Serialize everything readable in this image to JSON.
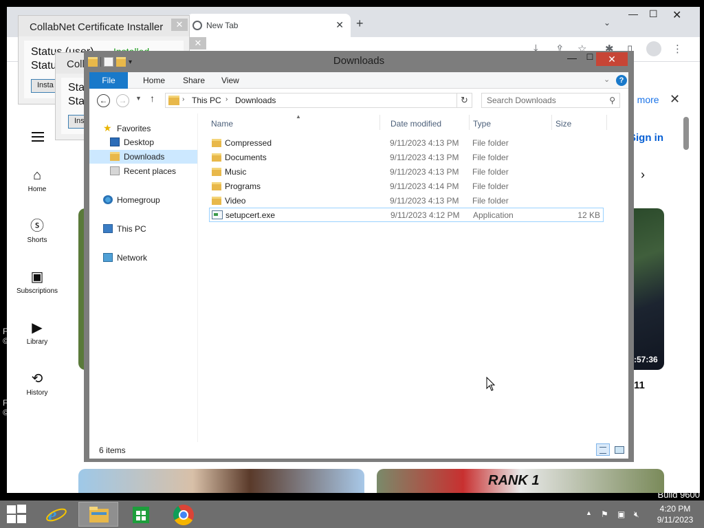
{
  "desktop": {
    "build_text": "Build 9600",
    "side_letters": [
      "F",
      "©",
      "F",
      "©"
    ]
  },
  "chrome": {
    "tab_title": "New Tab",
    "new_tab": "+",
    "learn_more": "n more",
    "sign_in": "Sign in",
    "sidebar": [
      {
        "label": "Home",
        "icon": "home-icon"
      },
      {
        "label": "Shorts",
        "icon": "shorts-icon"
      },
      {
        "label": "Subscriptions",
        "icon": "subscriptions-icon"
      },
      {
        "label": "Library",
        "icon": "library-icon"
      },
      {
        "label": "History",
        "icon": "history-icon"
      }
    ],
    "video_duration": ":57:36",
    "video_number": "11",
    "thumb_text": "RANK 1"
  },
  "cert_installer": {
    "title1": "CollabNet Certificate Installer",
    "title2": "Colla",
    "status_user": "Status (user)",
    "status_short": "Statu",
    "status_value": "Installed",
    "sta1": "Sta",
    "sta2": "Sta",
    "install_btn": "Insta",
    "install_btn2": "Ins"
  },
  "explorer": {
    "title": "Downloads",
    "ribbon_tabs": [
      "File",
      "Home",
      "Share",
      "View"
    ],
    "breadcrumb": [
      "This PC",
      "Downloads"
    ],
    "search_placeholder": "Search Downloads",
    "nav": {
      "favorites": "Favorites",
      "desktop": "Desktop",
      "downloads": "Downloads",
      "recent": "Recent places",
      "homegroup": "Homegroup",
      "this_pc": "This PC",
      "network": "Network"
    },
    "columns": {
      "name": "Name",
      "date": "Date modified",
      "type": "Type",
      "size": "Size"
    },
    "files": [
      {
        "name": "Compressed",
        "date": "9/11/2023 4:13 PM",
        "type": "File folder",
        "size": ""
      },
      {
        "name": "Documents",
        "date": "9/11/2023 4:13 PM",
        "type": "File folder",
        "size": ""
      },
      {
        "name": "Music",
        "date": "9/11/2023 4:13 PM",
        "type": "File folder",
        "size": ""
      },
      {
        "name": "Programs",
        "date": "9/11/2023 4:14 PM",
        "type": "File folder",
        "size": ""
      },
      {
        "name": "Video",
        "date": "9/11/2023 4:13 PM",
        "type": "File folder",
        "size": ""
      },
      {
        "name": "setupcert.exe",
        "date": "9/11/2023 4:12 PM",
        "type": "Application",
        "size": "12 KB"
      }
    ],
    "status": "6 items"
  },
  "taskbar": {
    "apps": [
      "internet-explorer",
      "file-explorer",
      "store",
      "chrome"
    ],
    "time": "4:20 PM",
    "date": "9/11/2023"
  },
  "colors": {
    "accent": "#1979ca",
    "close": "#c74536",
    "taskbar": "#6e6e6e"
  }
}
